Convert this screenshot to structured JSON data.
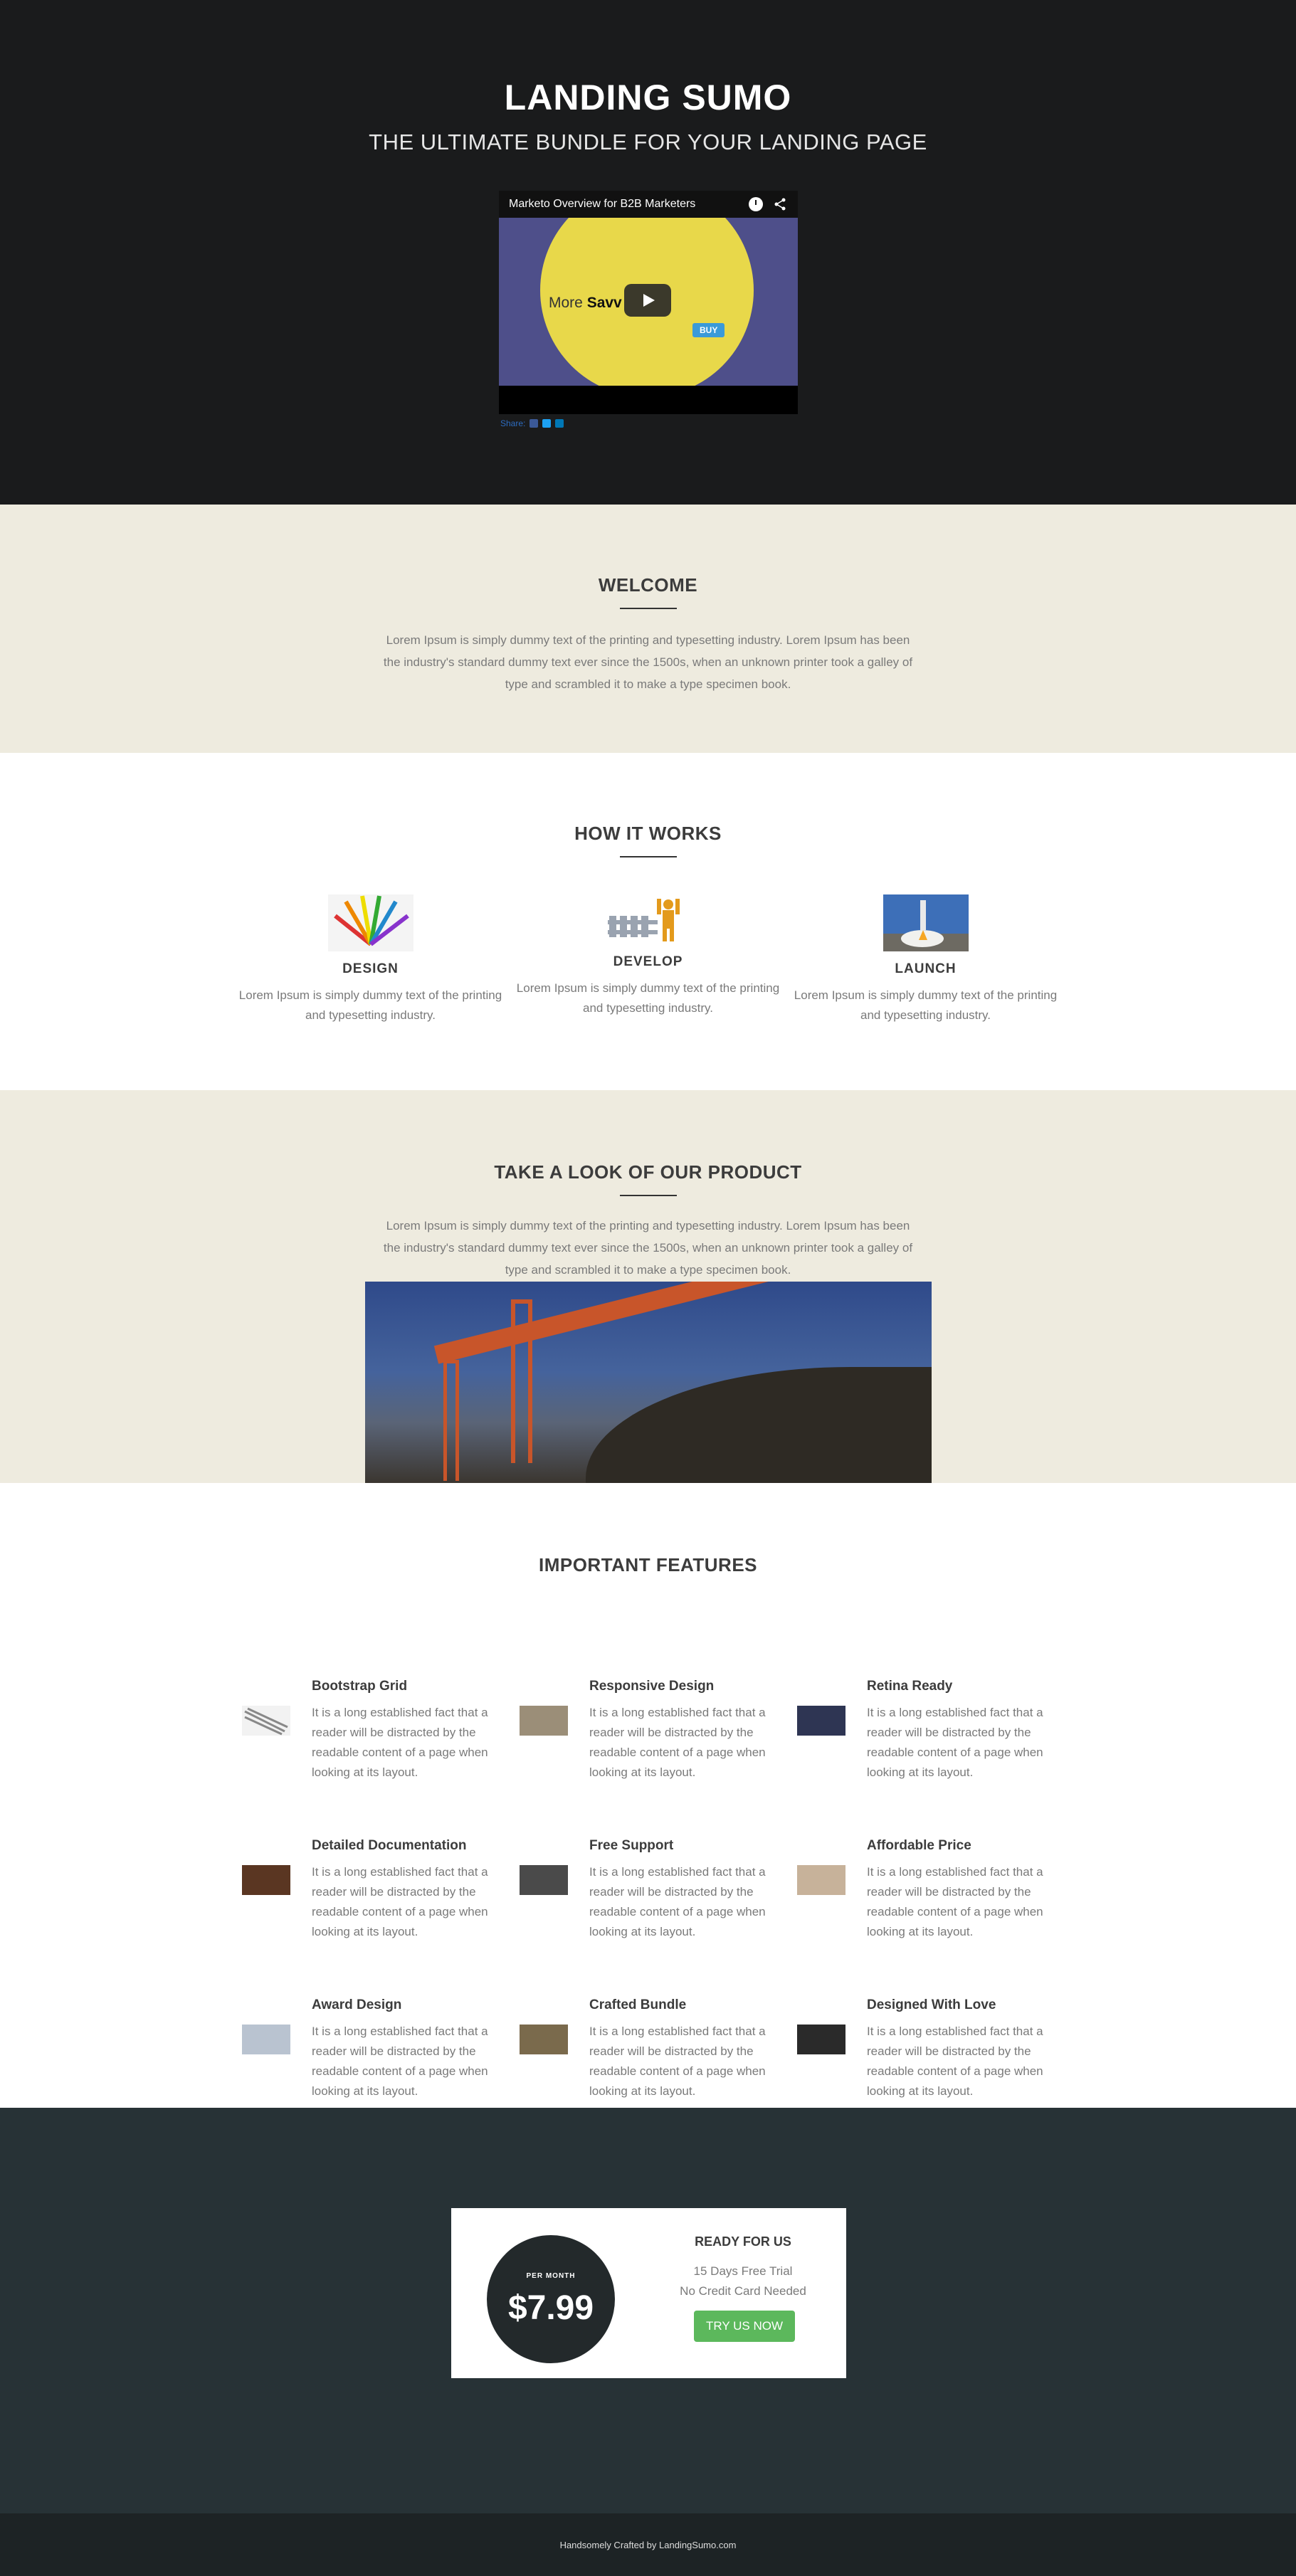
{
  "hero": {
    "title": "LANDING SUMO",
    "subtitle": "THE ULTIMATE BUNDLE FOR YOUR LANDING PAGE",
    "video": {
      "title": "Marketo Overview for B2B Marketers",
      "overlay_text_a": "More ",
      "overlay_text_b": "Savv",
      "buy_label": "BUY",
      "icons": [
        "clock-icon",
        "share-icon",
        "play-icon"
      ]
    },
    "share_label": "Share:"
  },
  "welcome": {
    "title": "WELCOME",
    "text": "Lorem Ipsum is simply dummy text of the printing and typesetting industry. Lorem Ipsum has been the industry's standard dummy text ever since the 1500s, when an unknown printer took a galley of type and scrambled it to make a type specimen book."
  },
  "how": {
    "title": "HOW IT WORKS",
    "steps": [
      {
        "title": "DESIGN",
        "text": "Lorem Ipsum is simply dummy text of the printing and typesetting industry."
      },
      {
        "title": "DEVELOP",
        "text": "Lorem Ipsum is simply dummy text of the printing and typesetting industry."
      },
      {
        "title": "LAUNCH",
        "text": "Lorem Ipsum is simply dummy text of the printing and typesetting industry."
      }
    ]
  },
  "product": {
    "title": "TAKE A LOOK OF OUR PRODUCT",
    "text": "Lorem Ipsum is simply dummy text of the printing and typesetting industry. Lorem Ipsum has been the industry's standard dummy text ever since the 1500s, when an unknown printer took a galley of type and scrambled it to make a type specimen book."
  },
  "features": {
    "title": "IMPORTANT FEATURES",
    "items": [
      {
        "title": "Bootstrap Grid",
        "text": "It is a long established fact that a reader will be distracted by the readable content of a page when looking at its layout."
      },
      {
        "title": "Responsive Design",
        "text": "It is a long established fact that a reader will be distracted by the readable content of a page when looking at its layout."
      },
      {
        "title": "Retina Ready",
        "text": "It is a long established fact that a reader will be distracted by the readable content of a page when looking at its layout."
      },
      {
        "title": "Detailed Documentation",
        "text": "It is a long established fact that a reader will be distracted by the readable content of a page when looking at its layout."
      },
      {
        "title": "Free Support",
        "text": "It is a long established fact that a reader will be distracted by the readable content of a page when looking at its layout."
      },
      {
        "title": "Affordable Price",
        "text": "It is a long established fact that a reader will be distracted by the readable content of a page when looking at its layout."
      },
      {
        "title": "Award Design",
        "text": "It is a long established fact that a reader will be distracted by the readable content of a page when looking at its layout."
      },
      {
        "title": "Crafted Bundle",
        "text": "It is a long established fact that a reader will be distracted by the readable content of a page when looking at its layout."
      },
      {
        "title": "Designed With Love",
        "text": "It is a long established fact that a reader will be distracted by the readable content of a page when looking at its layout."
      }
    ]
  },
  "pricing": {
    "per_label": "PER MONTH",
    "price": "$7.99",
    "ready_label": "READY FOR US",
    "trial_line1": "15 Days Free Trial",
    "trial_line2": "No Credit Card Needed",
    "button_label": "TRY US NOW",
    "button_color": "#5cb85c"
  },
  "footer": {
    "text": "Handsomely Crafted by LandingSumo.com"
  }
}
